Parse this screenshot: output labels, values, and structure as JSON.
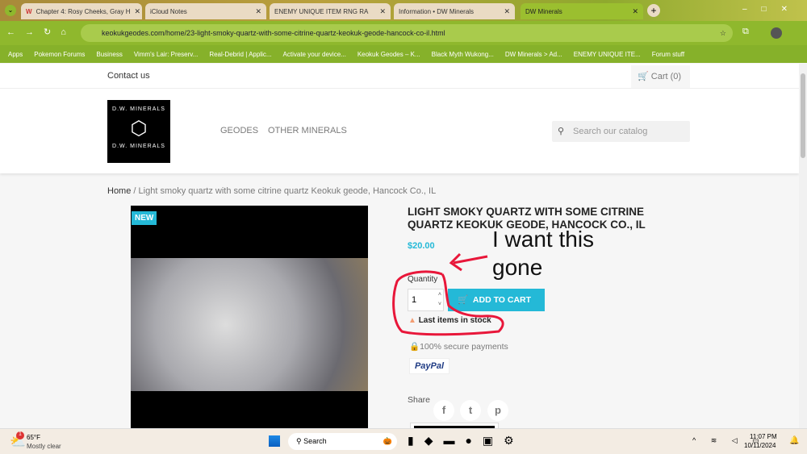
{
  "browser": {
    "tabs": [
      {
        "label": "Chapter 4: Rosy Cheeks, Gray H"
      },
      {
        "label": "iCloud Notes"
      },
      {
        "label": "ENEMY UNIQUE ITEM RNG RA"
      },
      {
        "label": "Information • DW Minerals"
      },
      {
        "label": "DW Minerals",
        "active": true
      }
    ],
    "url": "keokukgeodes.com/home/23-light-smoky-quartz-with-some-citrine-quartz-keokuk-geode-hancock-co-il.html",
    "bookmarks": [
      "Apps",
      "Pokemon Forums",
      "Business",
      "Vimm's Lair: Preserv...",
      "Real-Debrid | Applic...",
      "Activate your device...",
      "Keokuk Geodes – K...",
      "Black Myth Wukong...",
      "DW Minerals > Ad...",
      "ENEMY UNIQUE ITE...",
      "Forum stuff"
    ]
  },
  "site": {
    "contact": "Contact us",
    "cart": "Cart (0)",
    "logo_text": "D.W. MINERALS",
    "nav": [
      "GEODES",
      "OTHER MINERALS"
    ],
    "search_placeholder": "Search our catalog",
    "breadcrumb": {
      "home": "Home",
      "sep": "/",
      "current": "Light smoky quartz with some citrine quartz Keokuk geode, Hancock Co., IL"
    },
    "badge": "NEW",
    "title": "LIGHT SMOKY QUARTZ WITH SOME CITRINE QUARTZ KEOKUK GEODE, HANCOCK CO., IL",
    "price": "$20.00",
    "quantity_label": "Quantity",
    "quantity": "1",
    "add_to_cart": "ADD TO CART",
    "stock": "Last items in stock",
    "secure": "100% secure payments",
    "paypal": "PayPal",
    "share": "Share",
    "accent": "#24b9d7"
  },
  "annotation": {
    "line1": "I want this",
    "line2": "gone",
    "color": "#e8173a"
  },
  "taskbar": {
    "temp": "65°F",
    "weather": "Mostly clear",
    "search": "Search",
    "time": "11:07 PM",
    "date": "10/11/2024",
    "notif": "1"
  }
}
